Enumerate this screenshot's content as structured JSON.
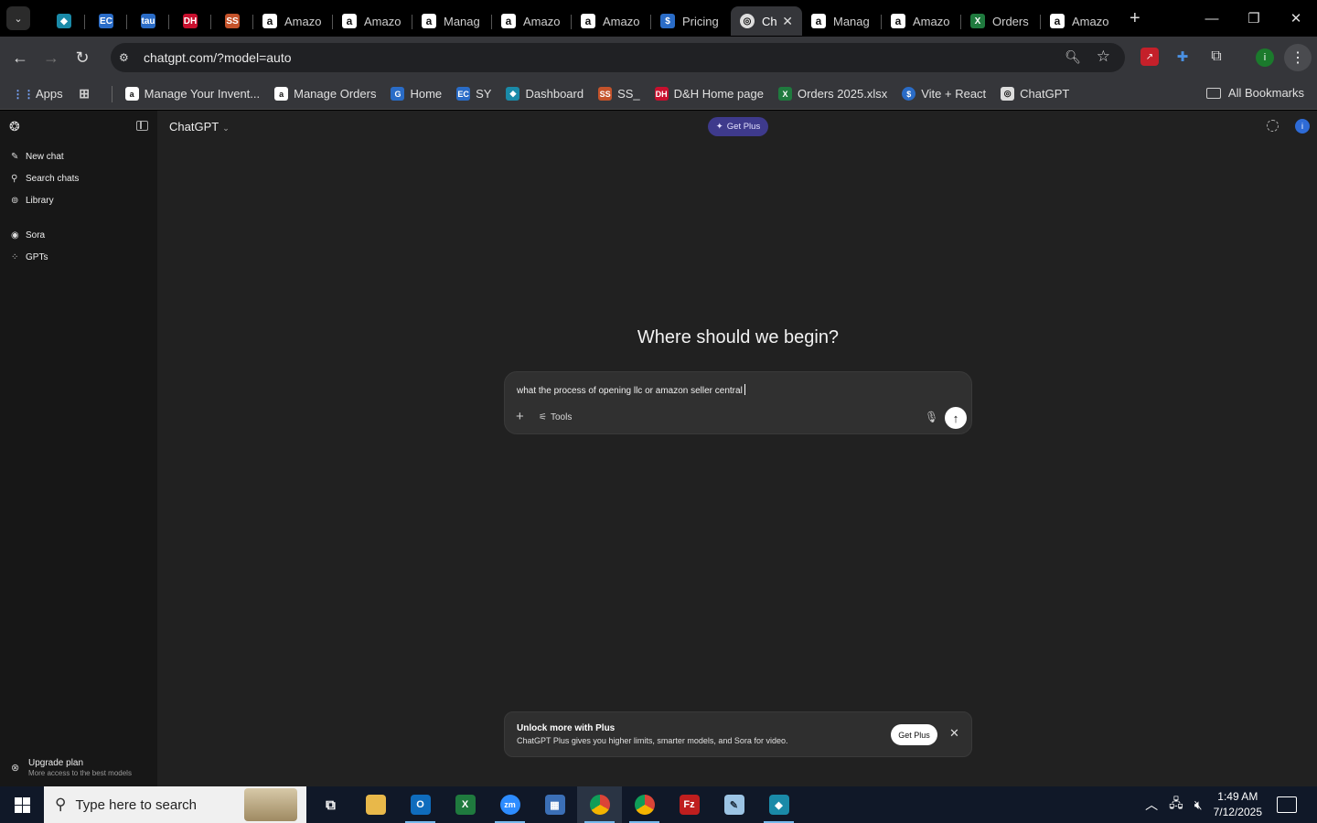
{
  "browser": {
    "tabs": [
      {
        "label": "",
        "favicon": "blue-diamond",
        "kind": "small"
      },
      {
        "label": "",
        "favicon": "ec",
        "kind": "small"
      },
      {
        "label": "",
        "favicon": "tau",
        "kind": "small"
      },
      {
        "label": "",
        "favicon": "dh",
        "kind": "small"
      },
      {
        "label": "",
        "favicon": "ss",
        "kind": "small"
      },
      {
        "label": "Amazo",
        "favicon": "amazon"
      },
      {
        "label": "Amazo",
        "favicon": "amazon"
      },
      {
        "label": "Manag",
        "favicon": "amazon"
      },
      {
        "label": "Amazo",
        "favicon": "amazon"
      },
      {
        "label": "Amazo",
        "favicon": "amazon"
      },
      {
        "label": "Pricing",
        "favicon": "dollar"
      },
      {
        "label": "Ch",
        "favicon": "chatgpt",
        "active": true
      },
      {
        "label": "Manag",
        "favicon": "amazon"
      },
      {
        "label": "Amazo",
        "favicon": "amazon"
      },
      {
        "label": "Orders",
        "favicon": "excel"
      },
      {
        "label": "Amazo",
        "favicon": "amazon"
      }
    ],
    "url": "chatgpt.com/?model=auto",
    "profile_initial": "i",
    "bookmarks": [
      {
        "label": "Apps",
        "icon": "apps-grid-icon"
      },
      {
        "label": "",
        "icon": "tab-groups-icon"
      },
      {
        "label": "Manage Your Invent...",
        "icon": "amazon-icon"
      },
      {
        "label": "Manage Orders",
        "icon": "amazon-icon"
      },
      {
        "label": "Home",
        "icon": "home-g-icon"
      },
      {
        "label": "SY",
        "icon": "ec-icon"
      },
      {
        "label": "Dashboard",
        "icon": "diamond-icon"
      },
      {
        "label": "SS_",
        "icon": "ss-icon"
      },
      {
        "label": "D&H Home page",
        "icon": "dh-icon"
      },
      {
        "label": "Orders 2025.xlsx",
        "icon": "excel-icon"
      },
      {
        "label": "Vite + React",
        "icon": "dollar-icon"
      },
      {
        "label": "ChatGPT",
        "icon": "chatgpt-icon"
      }
    ],
    "all_bookmarks": "All Bookmarks"
  },
  "chatgpt": {
    "sidebar": {
      "items": [
        {
          "label": "New chat",
          "icon": "edit-icon"
        },
        {
          "label": "Search chats",
          "icon": "search-icon"
        },
        {
          "label": "Library",
          "icon": "library-icon"
        },
        {
          "label": "Sora",
          "icon": "sora-icon"
        },
        {
          "label": "GPTs",
          "icon": "gpts-icon"
        }
      ],
      "upgrade_title": "Upgrade plan",
      "upgrade_subtitle": "More access to the best models"
    },
    "model_selector": "ChatGPT",
    "get_plus_top": "Get Plus",
    "user_initial": "i",
    "headline": "Where should we begin?",
    "composer": {
      "value": "what the process of opening llc or amazon seller central",
      "tools_label": "Tools"
    },
    "upsell": {
      "title": "Unlock more with Plus",
      "body": "ChatGPT Plus gives you higher limits, smarter models, and Sora for video.",
      "button": "Get Plus"
    }
  },
  "taskbar": {
    "search_placeholder": "Type here to search",
    "time": "1:49 AM",
    "date": "7/12/2025",
    "apps": [
      "task-view",
      "file-explorer",
      "outlook",
      "excel",
      "zoom",
      "calculator",
      "chrome",
      "chrome",
      "filezilla",
      "notepad",
      "app"
    ]
  }
}
